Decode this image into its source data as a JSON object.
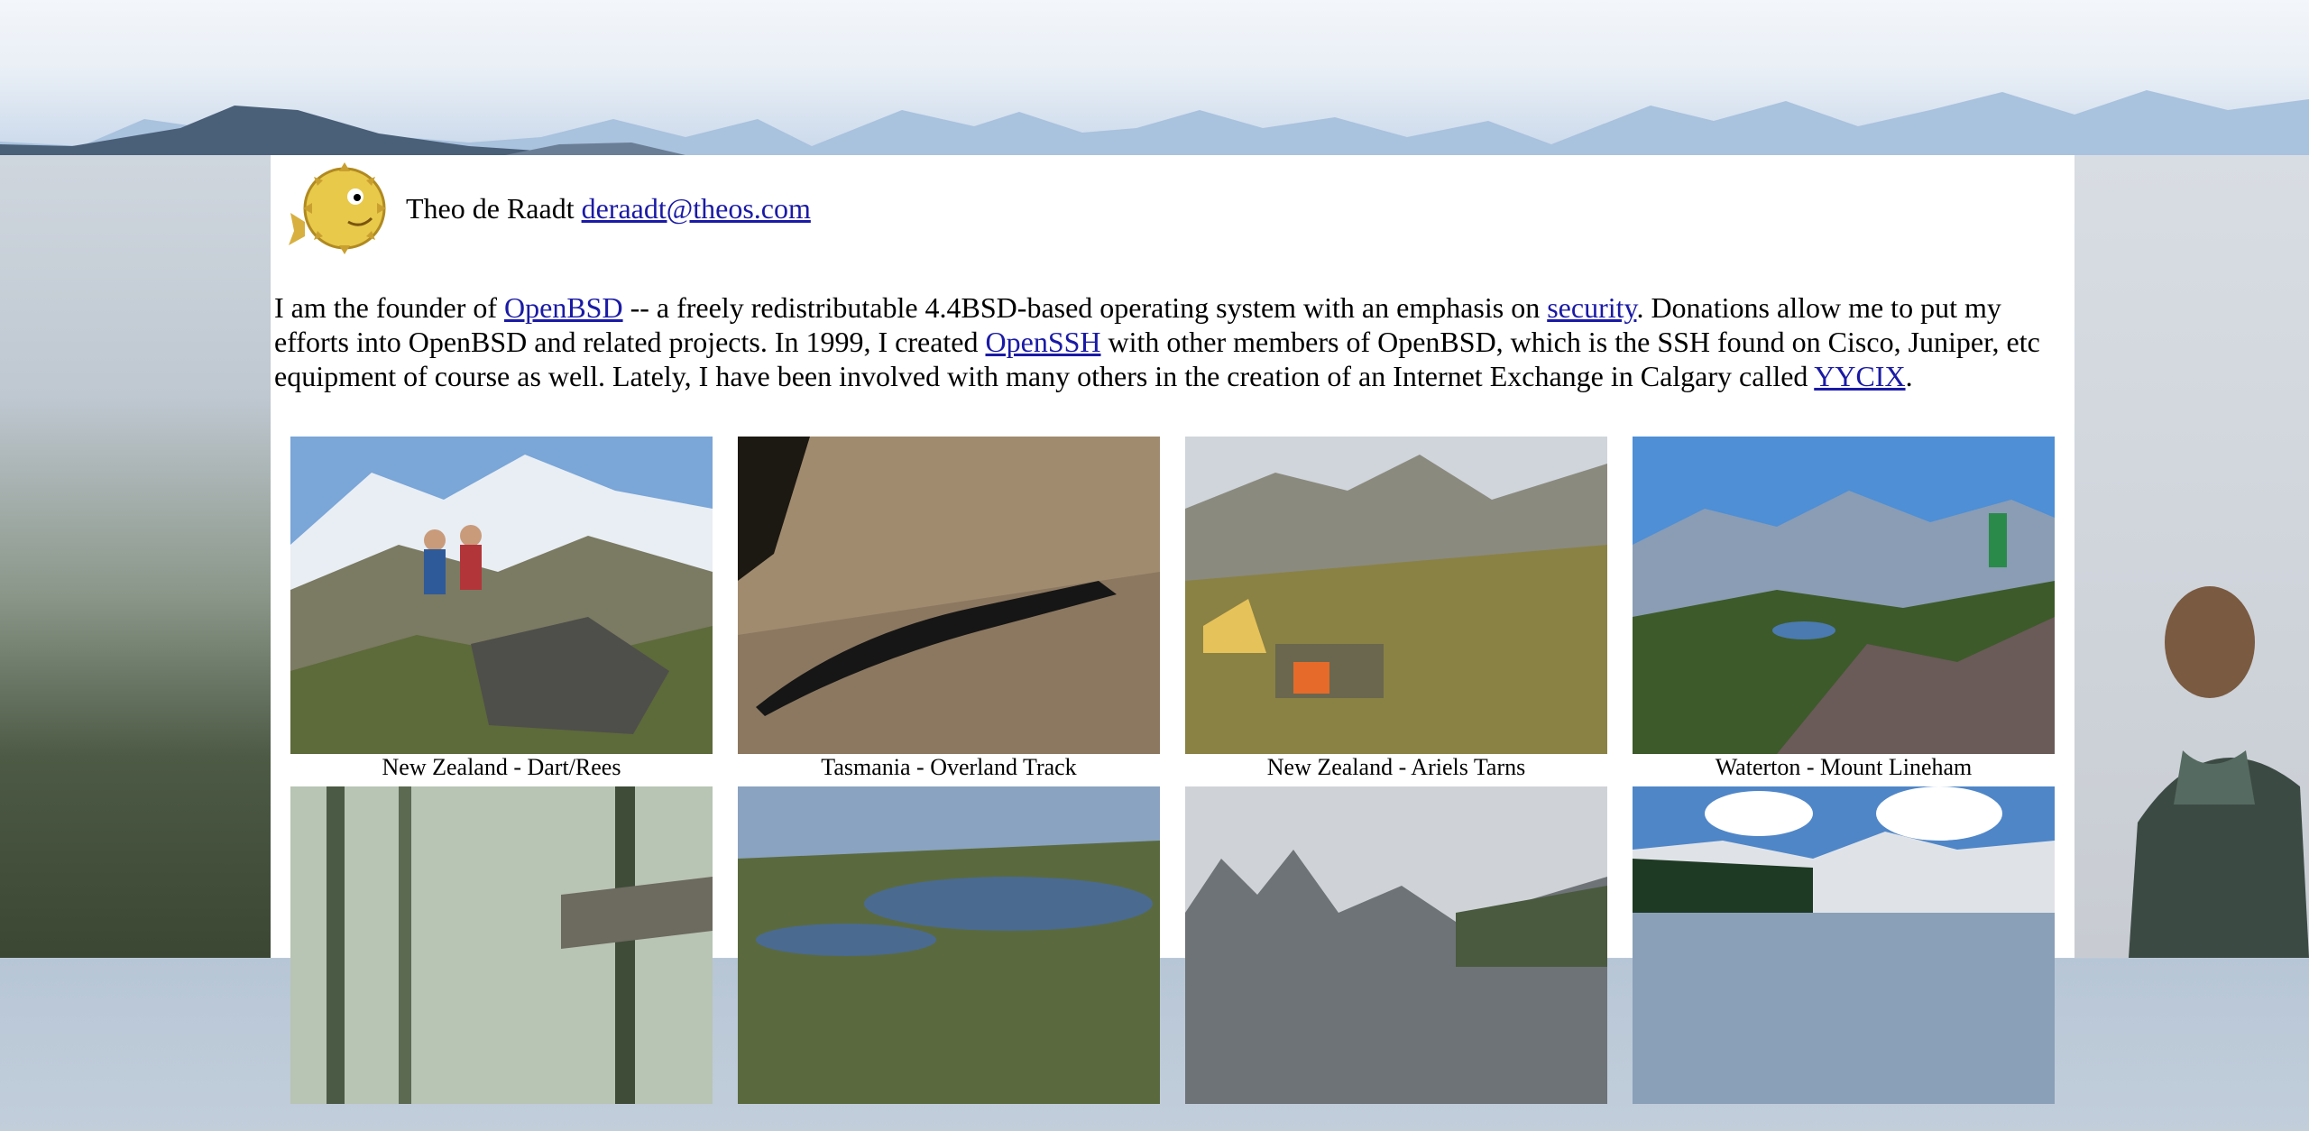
{
  "header": {
    "name": "Theo de Raadt",
    "email": "deraadt@theos.com",
    "logo_icon": "blowfish-logo-icon"
  },
  "intro": {
    "t1": "I am the founder of ",
    "link_openbsd": "OpenBSD",
    "t2": " -- a freely redistributable 4.4BSD-based operating system with an emphasis on ",
    "link_security": "security",
    "t3": ". Donations allow me to put my efforts into OpenBSD and related projects. In 1999, I created ",
    "link_openssh": "OpenSSH",
    "t4": " with other members of OpenBSD, which is the SSH found on Cisco, Juniper, etc equipment of course as well. Lately, I have been involved with many others in the creation of an Internet Exchange in Calgary called ",
    "link_yycix": "YYCIX",
    "t5": "."
  },
  "gallery": [
    {
      "caption": "New Zealand - Dart/Rees"
    },
    {
      "caption": "Tasmania - Overland Track"
    },
    {
      "caption": "New Zealand - Ariels Tarns"
    },
    {
      "caption": "Waterton - Mount Lineham"
    },
    {
      "caption": ""
    },
    {
      "caption": ""
    },
    {
      "caption": ""
    },
    {
      "caption": ""
    }
  ],
  "colors": {
    "link": "#1a1aa6",
    "panel": "#ffffff"
  }
}
